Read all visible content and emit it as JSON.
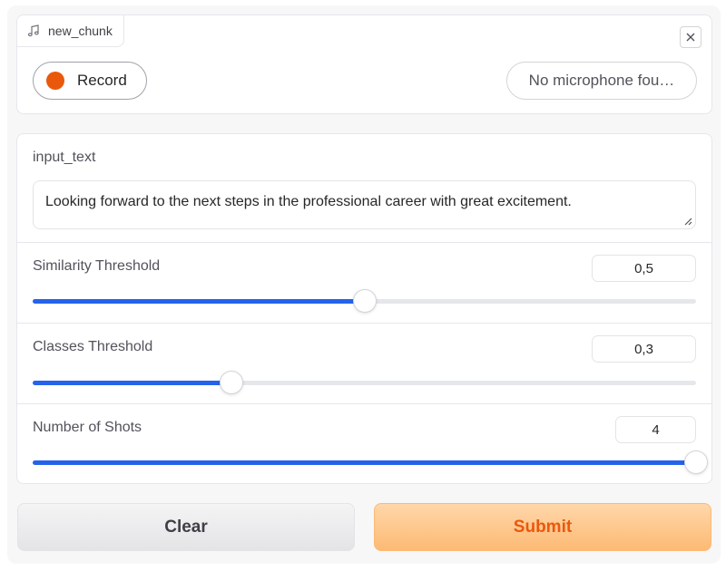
{
  "audio": {
    "label": "new_chunk",
    "record_label": "Record",
    "microphone_select": "No microphone fou…",
    "close_symbol": "✕"
  },
  "input_text": {
    "label": "input_text",
    "value": "Looking forward to the next steps in the professional career with great excitement."
  },
  "similarity": {
    "label": "Similarity Threshold",
    "value_text": "0,5",
    "fraction": 0.5
  },
  "classes": {
    "label": "Classes Threshold",
    "value_text": "0,3",
    "fraction": 0.3
  },
  "shots": {
    "label": "Number of Shots",
    "value_text": "4",
    "fraction": 1.0
  },
  "buttons": {
    "clear": "Clear",
    "submit": "Submit"
  },
  "colors": {
    "accent": "#2563eb",
    "record": "#ea580c",
    "submit_text": "#ea580c"
  }
}
